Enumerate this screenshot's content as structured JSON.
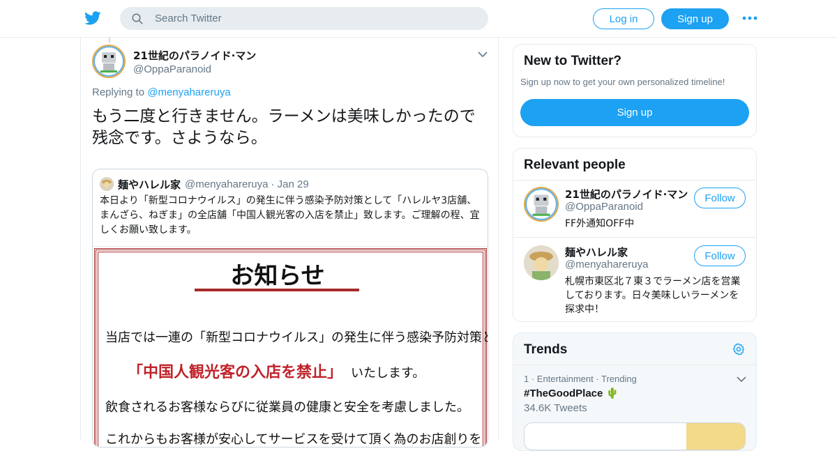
{
  "header": {
    "search_placeholder": "Search Twitter",
    "login_label": "Log in",
    "signup_label": "Sign up"
  },
  "tweet": {
    "author_name": "21世紀のパラノイド·マン",
    "author_handle": "@OppaParanoid",
    "replying_prefix": "Replying to",
    "replying_to": "@menyahareruya",
    "text": "もう二度と行きません。ラーメンは美味しかったので残念です。さようなら。"
  },
  "quote": {
    "name": "麺やハレル家",
    "handle": "@menyahareruya",
    "date": "· Jan 29",
    "text": "本日より「新型コロナウイルス」の発生に伴う感染予防対策として「ハレルヤ3店舗、まんざら、ねぎま」の全店舗「中国人観光客の入店を禁止」致します。ご理解の程、宜しくお願い致します。",
    "notice_title": "お知らせ",
    "notice_line1": "当店では一連の「新型コロナウイルス」の発生に伴う感染予防対策として",
    "notice_line2": "「中国人観光客の入店を禁止」",
    "notice_line2b": "いたします。",
    "notice_line3": "飲食されるお客様ならびに従業員の健康と安全を考慮しました。",
    "notice_line4": "これからもお客様が安心してサービスを受けて頂く為のお店創りを"
  },
  "new_to_twitter": {
    "title": "New to Twitter?",
    "subtitle": "Sign up now to get your own personalized timeline!",
    "button": "Sign up"
  },
  "relevant_people": {
    "title": "Relevant people",
    "people": [
      {
        "name": "21世紀のパラノイド·マン",
        "handle": "@OppaParanoid",
        "bio": "FF外通知OFF中",
        "follow": "Follow"
      },
      {
        "name": "麺やハレル家",
        "handle": "@menyahareruya",
        "bio": "札幌市東区北７東３でラーメン店を営業しております。日々美味しいラーメンを探求中！",
        "follow": "Follow"
      }
    ]
  },
  "trends": {
    "title": "Trends",
    "items": [
      {
        "rank_meta": "1 · Entertainment · Trending",
        "name": "#TheGoodPlace 🌵",
        "count": "34.6K Tweets"
      }
    ]
  },
  "colors": {
    "brand": "#1da1f2",
    "muted": "#657786",
    "notice_red": "#a52a2a"
  }
}
